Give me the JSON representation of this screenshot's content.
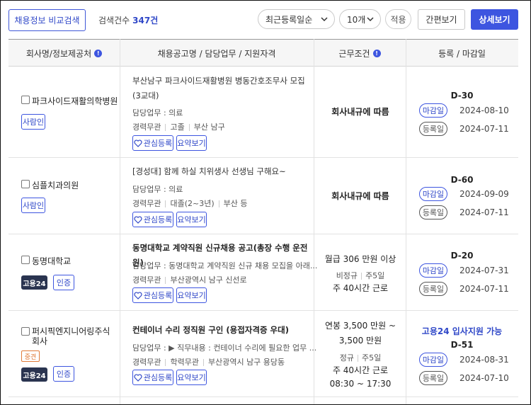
{
  "toolbar": {
    "compare_label": "채용정보 비교검색",
    "result_label": "검색건수",
    "result_count": "347",
    "result_unit": "건",
    "sort_value": "최근등록일순",
    "count_value": "10개",
    "apply_label": "적용",
    "simple_view_label": "간편보기",
    "detail_view_label": "상세보기"
  },
  "table": {
    "headers": {
      "company": "회사명/정보제공처",
      "title": "채용공고명 / 담당업무 / 지원자격",
      "condition": "근무조건",
      "date": "등록 / 마감일"
    },
    "action_favorite": "관심등록",
    "action_summary": "요약보기",
    "label_deadline": "마감일",
    "label_registered": "등록일",
    "rows": [
      {
        "company": "파크사이드재활의학병원",
        "source_tag": "사람인",
        "title": "부산남구 파크사이드재활병원 병동간호조무사 모집 (3교대)",
        "duty": "담당업무 : 의료",
        "meta1": "경력무관",
        "meta2": "고졸",
        "meta3": "부산 남구",
        "condition": "회사내규에 따름",
        "dday": "D-30",
        "deadline": "2024-08-10",
        "registered": "2024-07-11"
      },
      {
        "company": "심플치과의원",
        "source_tag": "사람인",
        "title": "[경성대] 함께 하실 치위생사 선생님 구해요~",
        "duty": "담당업무 : 의료",
        "meta1": "경력무관",
        "meta2": "대졸(2~3년)",
        "meta3": "부산 등",
        "condition": "회사내규에 따름",
        "dday": "D-60",
        "deadline": "2024-09-09",
        "registered": "2024-07-11"
      },
      {
        "company": "동명대학교",
        "source_tag": "고용24",
        "cert_tag": "인증",
        "title": "동명대학교 계약직원 신규채용 공고(총장 수행 운전원)",
        "duty": "담당업무 : 동명대학교 계약직원 신규 채용 모집을 아래...",
        "meta1": "경력무관",
        "meta2": "부산광역시 남구 신선로",
        "salary": "월급 306 만원 이상",
        "emp_type": "비정규",
        "days": "주5일",
        "hours": "주 40시간 근로",
        "dday": "D-20",
        "deadline": "2024-07-31",
        "registered": "2024-07-11"
      },
      {
        "company": "퍼시픽엔지니어링주식회사",
        "small_tag": "중견",
        "source_tag": "고용24",
        "cert_tag": "인증",
        "title": "컨테이너 수리 정직원 구인 (용접자격증 우대)",
        "duty": "담당업무 : ▶ 직무내용 : 컨테이너 수리에 필요한 업무 ...",
        "meta1": "경력무관",
        "meta2": "학력무관",
        "meta3": "부산광역시 남구 용당동",
        "salary1": "연봉 3,500 만원 ~",
        "salary2": "3,500 만원",
        "emp_type": "정규",
        "days": "주5일",
        "hours": "주 40시간 근로",
        "time": "08:30 ~ 17:30",
        "apply_tag": "고용24 입사지원 가능",
        "dday": "D-51",
        "deadline": "2024-08-31",
        "registered": "2024-07-10"
      }
    ]
  }
}
